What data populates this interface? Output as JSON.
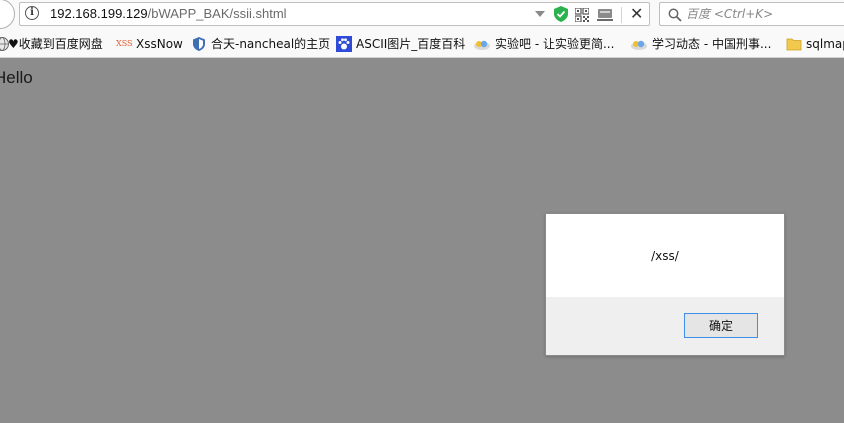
{
  "browser": {
    "url_host": "192.168.199.129",
    "url_path": "/bWAPP_BAK/ssii.shtml",
    "search_placeholder": "百度 <Ctrl+K>",
    "close_symbol": "✕",
    "info_symbol": "i"
  },
  "bookmarks": [
    {
      "label": "♥收藏到百度网盘",
      "icon": "globe-icon"
    },
    {
      "label": "XssNow",
      "icon": "xss-icon",
      "icon_text": "XSS"
    },
    {
      "label": "合天-nancheal的主页",
      "icon": "shield-icon"
    },
    {
      "label": "ASCII图片_百度百科",
      "icon": "paw-icon"
    },
    {
      "label": "实验吧 - 让实验更简...",
      "icon": "cloud-icon"
    },
    {
      "label": "学习动态 - 中国刑事...",
      "icon": "cloud-icon"
    },
    {
      "label": "sqlmap",
      "icon": "folder-icon"
    }
  ],
  "page": {
    "text": "Hello"
  },
  "dialog": {
    "message": "/xss/",
    "ok_label": "确定"
  },
  "colors": {
    "page_background": "#8c8c8c",
    "accent": "#3c8ee6",
    "shield_green": "#2bb24c"
  }
}
